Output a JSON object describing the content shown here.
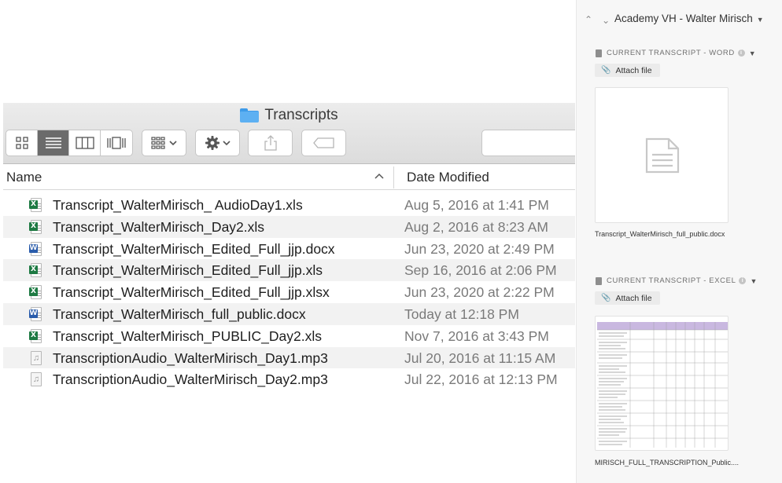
{
  "finder": {
    "title": "Transcripts",
    "columns": {
      "name": "Name",
      "date": "Date Modified"
    },
    "files": [
      {
        "name": "Transcript_WalterMirisch_ AudioDay1.xls",
        "date": "Aug 5, 2016 at 1:41 PM",
        "type": "xls"
      },
      {
        "name": "Transcript_WalterMirisch_Day2.xls",
        "date": "Aug 2, 2016 at 8:23 AM",
        "type": "xls"
      },
      {
        "name": "Transcript_WalterMirisch_Edited_Full_jjp.docx",
        "date": "Jun 23, 2020 at 2:49 PM",
        "type": "docx"
      },
      {
        "name": "Transcript_WalterMirisch_Edited_Full_jjp.xls",
        "date": "Sep 16, 2016 at 2:06 PM",
        "type": "xls"
      },
      {
        "name": "Transcript_WalterMirisch_Edited_Full_jjp.xlsx",
        "date": "Jun 23, 2020 at 2:22 PM",
        "type": "xlsx"
      },
      {
        "name": "Transcript_WalterMirisch_full_public.docx",
        "date": "Today at 12:18 PM",
        "type": "docx"
      },
      {
        "name": "Transcript_WalterMirisch_PUBLIC_Day2.xls",
        "date": "Nov 7, 2016 at 3:43 PM",
        "type": "xls"
      },
      {
        "name": "TranscriptionAudio_WalterMirisch_Day1.mp3",
        "date": "Jul 20, 2016 at 11:15 AM",
        "type": "mp3"
      },
      {
        "name": "TranscriptionAudio_WalterMirisch_Day2.mp3",
        "date": "Jul 22, 2016 at 12:13 PM",
        "type": "mp3"
      }
    ],
    "icons": {
      "view_modes": [
        "icon-view-icon",
        "list-view-icon",
        "column-view-icon",
        "gallery-view-icon"
      ],
      "toolbar": [
        "group-icon",
        "gear-icon",
        "share-icon",
        "tag-icon"
      ]
    }
  },
  "panel": {
    "record_title": "Academy VH - Walter Mirisch",
    "word": {
      "label": "CURRENT TRANSCRIPT - WORD",
      "attach_label": "Attach file",
      "filename": "Transcript_WalterMirisch_full_public.docx"
    },
    "excel": {
      "label": "CURRENT TRANSCRIPT - EXCEL",
      "attach_label": "Attach file",
      "filename": "MIRISCH_FULL_TRANSCRIPTION_Public...."
    }
  },
  "colors": {
    "excel_green": "#1e7a43",
    "word_blue": "#2a5cab",
    "folder_blue": "#5db0f2",
    "selected_view": "#6b6b6b",
    "sheet_header": "#c9b8e0"
  }
}
